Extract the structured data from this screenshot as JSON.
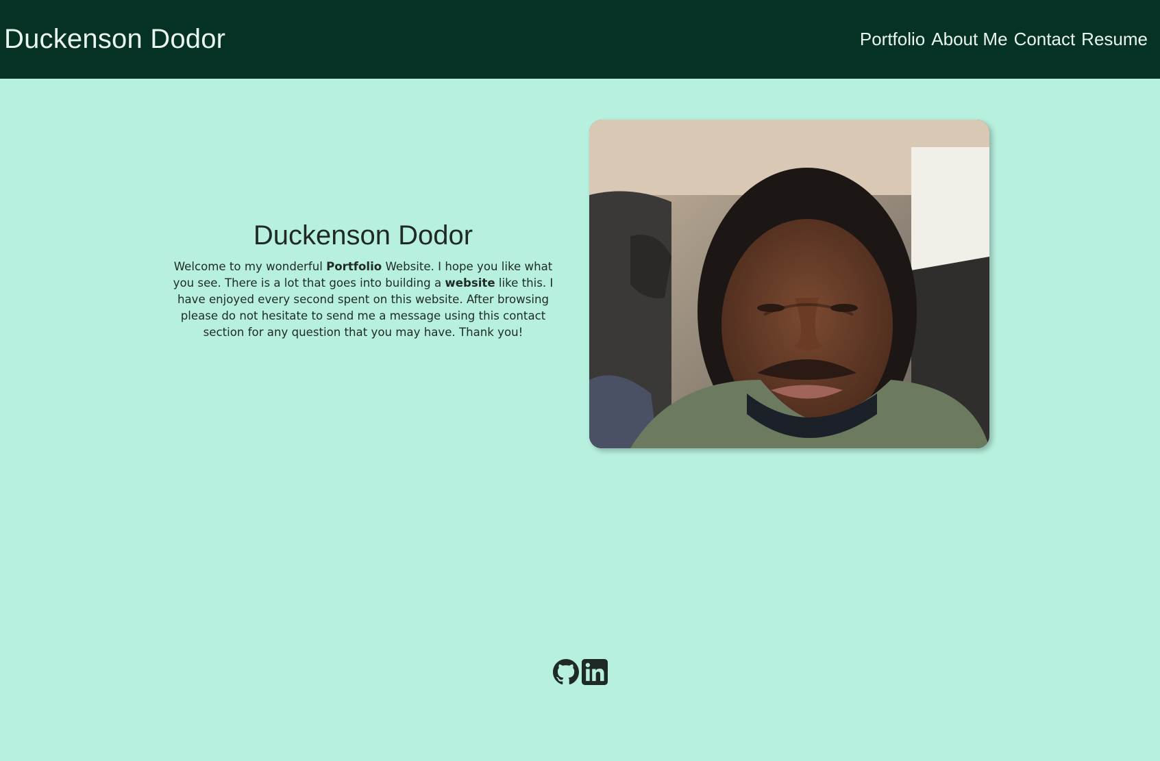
{
  "header": {
    "brand": "Duckenson Dodor",
    "nav": [
      "Portfolio",
      "About Me",
      "Contact",
      "Resume"
    ]
  },
  "intro": {
    "title": "Duckenson Dodor",
    "text_1": "Welcome to my wonderful ",
    "bold_1": "Portfolio",
    "text_2": " Website. I hope you like what you see. There is a lot that goes into building a ",
    "bold_2": "website",
    "text_3": " like this. I have enjoyed every second spent on this website. After browsing please do not hesitate to send me a message using this contact section for any question that you may have. Thank you!"
  },
  "photo": {
    "alt": "Portrait of Duckenson Dodor"
  },
  "social": {
    "icons": [
      "github-icon",
      "linkedin-icon"
    ]
  },
  "colors": {
    "header_bg": "#053224",
    "page_bg": "#b7f0de",
    "text": "#1f2a26"
  }
}
